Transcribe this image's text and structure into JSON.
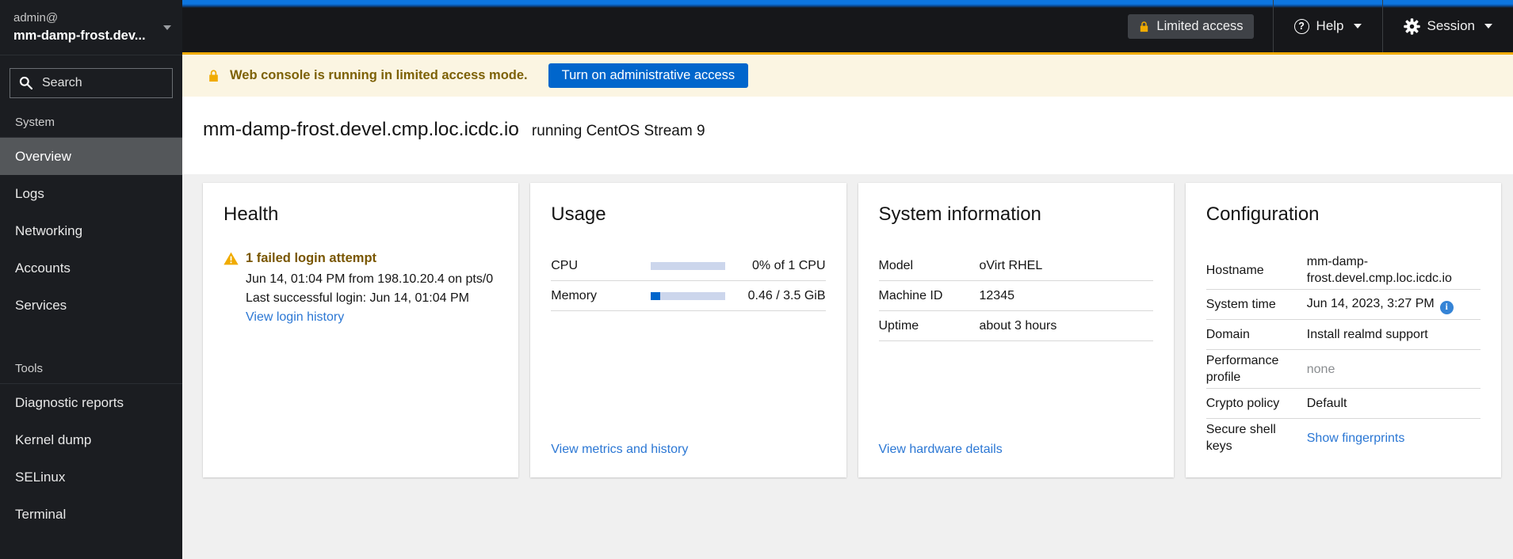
{
  "colors": {
    "accent_blue": "#0066cc",
    "link_blue": "#2b77d4",
    "warning_gold": "#f0ab00",
    "alert_text_gold": "#795600",
    "banner_bg": "#fbf5e2",
    "sidebar_bg": "#1b1d21",
    "masthead_bg": "#16171a",
    "selected_nav_bg": "#54575a",
    "content_bg": "#f0f0f0"
  },
  "icons": {
    "help_glyph": "?",
    "info_glyph": "i"
  },
  "brand": {
    "user": "admin@",
    "host": "mm-damp-frost.dev..."
  },
  "sidebar": {
    "search_placeholder": "Search",
    "sections": [
      {
        "label": "System",
        "items": [
          {
            "label": "Overview",
            "selected": true
          },
          {
            "label": "Logs"
          },
          {
            "label": "Networking"
          },
          {
            "label": "Accounts"
          },
          {
            "label": "Services"
          }
        ]
      },
      {
        "label": "Tools",
        "items": [
          {
            "label": "Diagnostic reports"
          },
          {
            "label": "Kernel dump"
          },
          {
            "label": "SELinux"
          },
          {
            "label": "Terminal"
          }
        ]
      }
    ]
  },
  "masthead": {
    "limited_access_label": "Limited access",
    "help_label": "Help",
    "session_label": "Session"
  },
  "banner": {
    "message": "Web console is running in limited access mode.",
    "action_label": "Turn on administrative access"
  },
  "page": {
    "hostname": "mm-damp-frost.devel.cmp.loc.icdc.io",
    "os": "running CentOS Stream 9"
  },
  "health": {
    "title": "Health",
    "alert_title": "1 failed login attempt",
    "line1": "Jun 14, 01:04 PM from 198.10.20.4 on pts/0",
    "line2": "Last successful login: Jun 14, 01:04 PM",
    "link_label": "View login history"
  },
  "usage": {
    "title": "Usage",
    "rows": [
      {
        "label": "CPU",
        "percent": 0,
        "value": "0% of 1 CPU"
      },
      {
        "label": "Memory",
        "percent": 13,
        "value": "0.46 / 3.5 GiB"
      }
    ],
    "link_label": "View metrics and history"
  },
  "system_information": {
    "title": "System information",
    "rows": [
      {
        "label": "Model",
        "value": "oVirt RHEL"
      },
      {
        "label": "Machine ID",
        "value": "12345"
      },
      {
        "label": "Uptime",
        "value": "about 3 hours"
      }
    ],
    "link_label": "View hardware details"
  },
  "configuration": {
    "title": "Configuration",
    "rows": [
      {
        "label": "Hostname",
        "value": "mm-damp-frost.devel.cmp.loc.icdc.io"
      },
      {
        "label": "System time",
        "value": "Jun 14, 2023, 3:27 PM"
      },
      {
        "label": "Domain",
        "value": "Install realmd support"
      },
      {
        "label": "Performance profile",
        "value": "none"
      },
      {
        "label": "Crypto policy",
        "value": "Default"
      },
      {
        "label": "Secure shell keys",
        "value": "Show fingerprints"
      }
    ]
  }
}
